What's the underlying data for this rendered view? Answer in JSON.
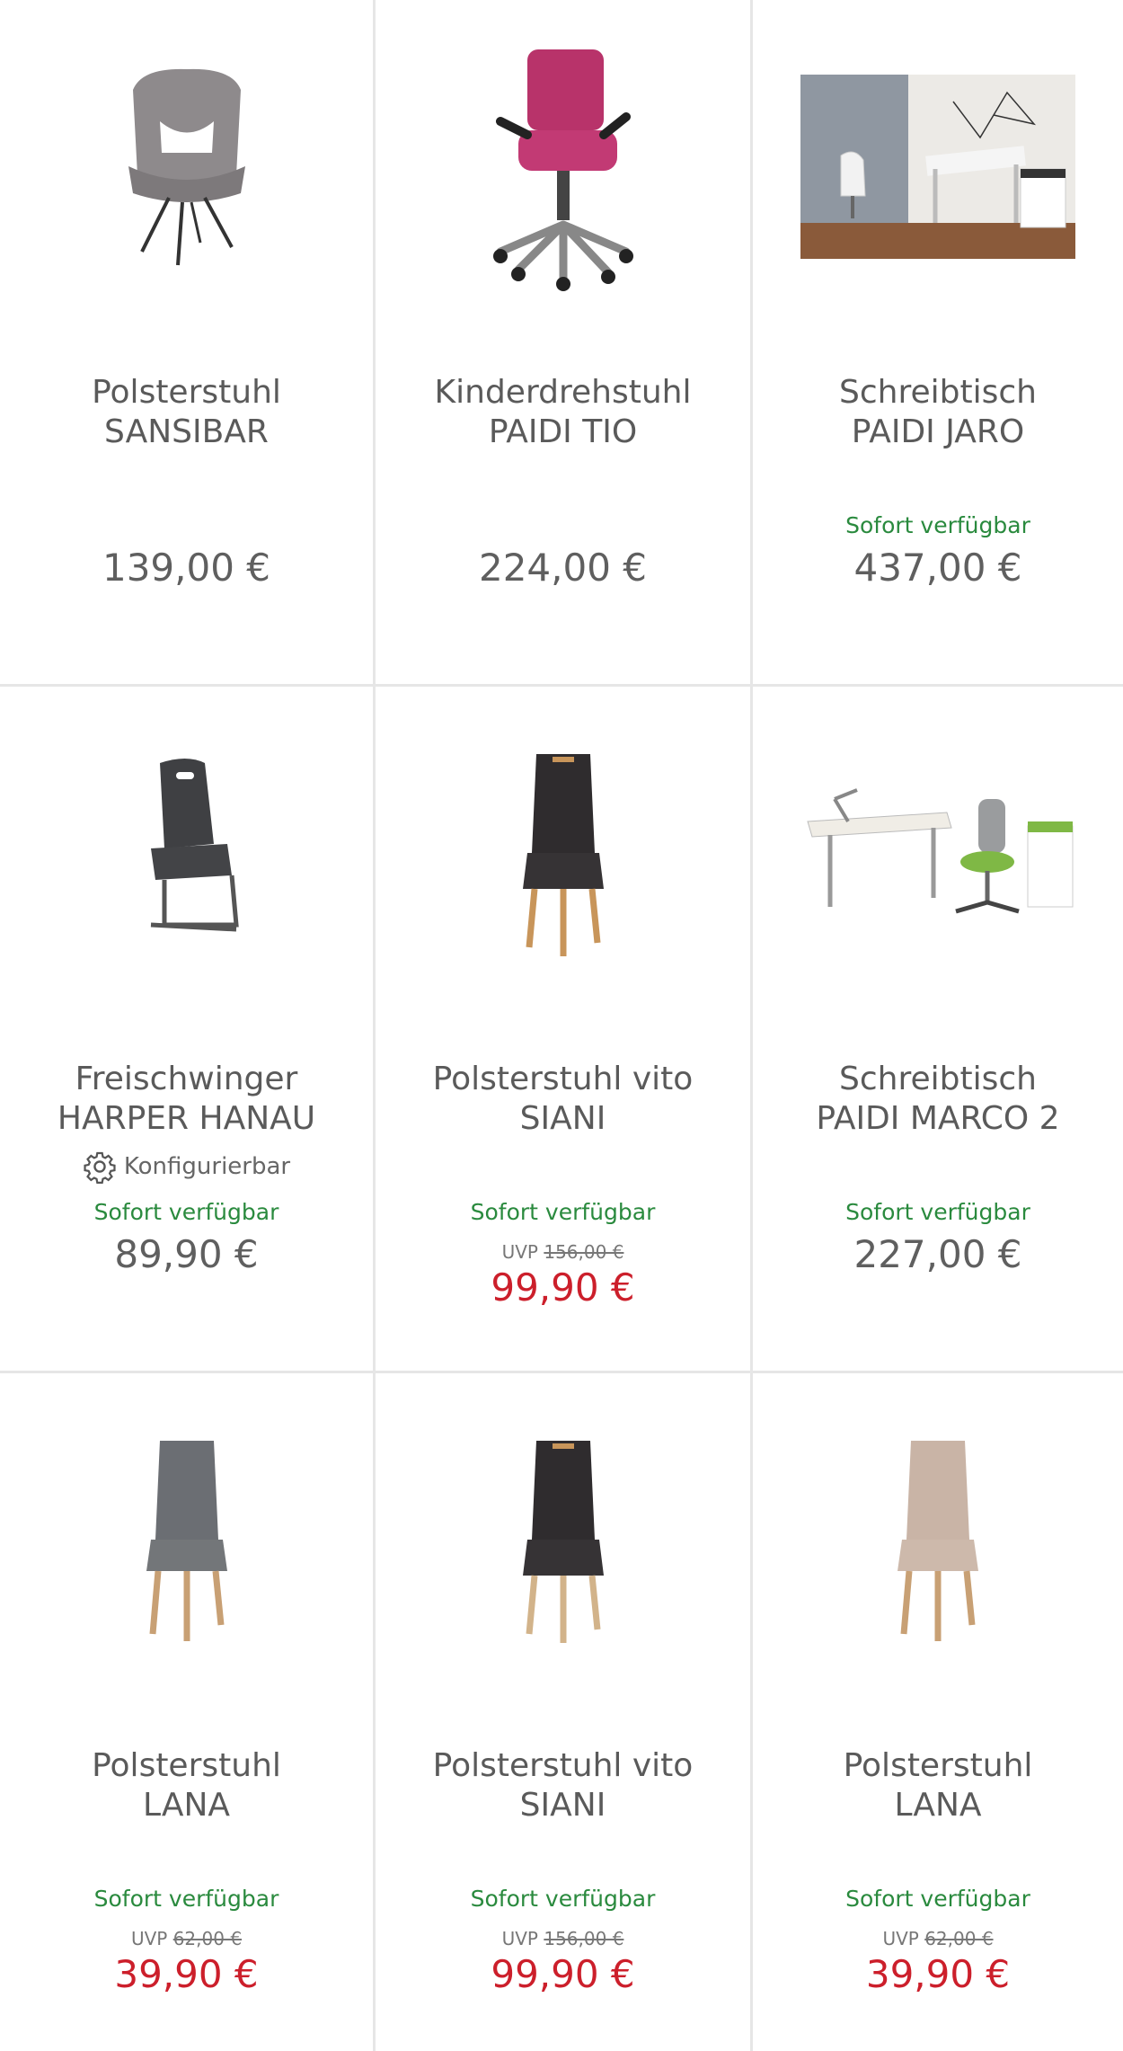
{
  "products": [
    {
      "title_line1": "Polsterstuhl",
      "title_line2": "SANSIBAR",
      "configurable": "",
      "availability": "",
      "uvp_label": "",
      "uvp_price": "",
      "price": "139,00 €",
      "image": "grey-armchair-image"
    },
    {
      "title_line1": "Kinderdrehstuhl",
      "title_line2": "PAIDI TIO",
      "configurable": "",
      "availability": "",
      "uvp_label": "",
      "uvp_price": "",
      "price": "224,00 €",
      "image": "pink-office-chair-image"
    },
    {
      "title_line1": "Schreibtisch",
      "title_line2": "PAIDI JARO",
      "configurable": "",
      "availability": "Sofort verfügbar",
      "uvp_label": "",
      "uvp_price": "",
      "price": "437,00 €",
      "image": "desk-room-photo"
    },
    {
      "title_line1": "Freischwinger",
      "title_line2": "HARPER HANAU",
      "configurable": "Konfigurierbar",
      "availability": "Sofort verfügbar",
      "uvp_label": "",
      "uvp_price": "",
      "price": "89,90 €",
      "image": "cantilever-chair-image"
    },
    {
      "title_line1": "Polsterstuhl vito",
      "title_line2": "SIANI",
      "configurable": "",
      "availability": "Sofort verfügbar",
      "uvp_label": "UVP",
      "uvp_price": "156,00 €",
      "price": "99,90 €",
      "image": "dark-chair-handle-image"
    },
    {
      "title_line1": "Schreibtisch",
      "title_line2": "PAIDI MARCO 2",
      "configurable": "",
      "availability": "Sofort verfügbar",
      "uvp_label": "",
      "uvp_price": "",
      "price": "227,00 €",
      "image": "desk-set-image"
    },
    {
      "title_line1": "Polsterstuhl",
      "title_line2": "LANA",
      "configurable": "",
      "availability": "Sofort verfügbar",
      "uvp_label": "UVP",
      "uvp_price": "62,00 €",
      "price": "39,90 €",
      "image": "grey-dining-chair-image"
    },
    {
      "title_line1": "Polsterstuhl vito",
      "title_line2": "SIANI",
      "configurable": "",
      "availability": "Sofort verfügbar",
      "uvp_label": "UVP",
      "uvp_price": "156,00 €",
      "price": "99,90 €",
      "image": "dark-chair-handle-image"
    },
    {
      "title_line1": "Polsterstuhl",
      "title_line2": "LANA",
      "configurable": "",
      "availability": "Sofort verfügbar",
      "uvp_label": "UVP",
      "uvp_price": "62,00 €",
      "price": "39,90 €",
      "image": "beige-dining-chair-image"
    }
  ],
  "colors": {
    "available_green": "#2a8a3e",
    "sale_red": "#cc1f2b",
    "text_grey": "#5a5a5a",
    "divider": "#e6e6e6"
  }
}
